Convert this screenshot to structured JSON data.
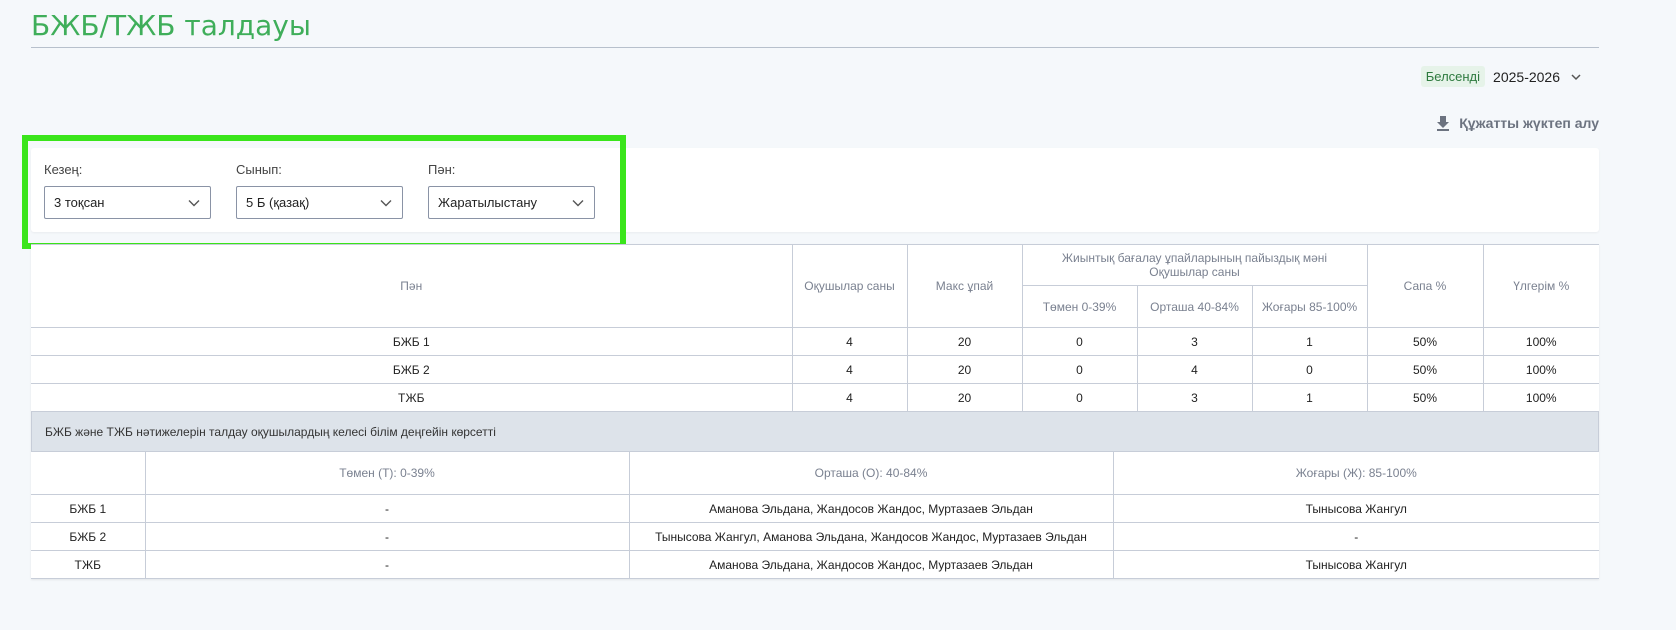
{
  "header": {
    "title": "БЖБ/ТЖБ талдауы"
  },
  "year_selector": {
    "badge": "Белсенді",
    "value": "2025-2026"
  },
  "download": {
    "label": "Құжатты жүктеп алу"
  },
  "filters": {
    "period": {
      "label": "Кезең:",
      "value": "3 тоқсан"
    },
    "class": {
      "label": "Сынып:",
      "value": "5 Б (қазақ)"
    },
    "subject": {
      "label": "Пән:",
      "value": "Жаратылыстану"
    }
  },
  "summary_table": {
    "headers": {
      "subject": "Пән",
      "students": "Оқушылар саны",
      "max_score": "Макс ұпай",
      "group": "Жиынтық бағалау ұпайларының пайыздық мәні Оқушылар саны",
      "low": "Төмен 0-39%",
      "mid": "Орташа 40-84%",
      "high": "Жоғары 85-100%",
      "quality": "Сапа %",
      "success": "Үлгерім %"
    },
    "rows": [
      {
        "subject": "БЖБ 1",
        "students": "4",
        "max": "20",
        "low": "0",
        "mid": "3",
        "high": "1",
        "quality": "50%",
        "success": "100%"
      },
      {
        "subject": "БЖБ 2",
        "students": "4",
        "max": "20",
        "low": "0",
        "mid": "4",
        "high": "0",
        "quality": "50%",
        "success": "100%"
      },
      {
        "subject": "ТЖБ",
        "students": "4",
        "max": "20",
        "low": "0",
        "mid": "3",
        "high": "1",
        "quality": "50%",
        "success": "100%"
      }
    ]
  },
  "note": "БЖБ және ТЖБ нәтижелерін талдау оқушылардың келесі білім деңгейін көрсетті",
  "levels_table": {
    "headers": {
      "blank": "",
      "low": "Төмен (Т): 0-39%",
      "mid": "Орташа (О): 40-84%",
      "high": "Жоғары (Ж): 85-100%"
    },
    "rows": [
      {
        "name": "БЖБ 1",
        "low": "-",
        "mid": "Аманова Эльдана, Жандосов Жандос, Муртазаев Эльдан",
        "high": "Тынысова Жангул"
      },
      {
        "name": "БЖБ 2",
        "low": "-",
        "mid": "Тынысова Жангул, Аманова Эльдана, Жандосов Жандос, Муртазаев Эльдан",
        "high": "-"
      },
      {
        "name": "ТЖБ",
        "low": "-",
        "mid": "Аманова Эльдана, Жандосов Жандос, Муртазаев Эльдан",
        "high": "Тынысова Жангул"
      }
    ]
  },
  "colors": {
    "title": "#3fae5a",
    "highlight": "#3ae51b",
    "note_bg": "#dde3ea"
  }
}
